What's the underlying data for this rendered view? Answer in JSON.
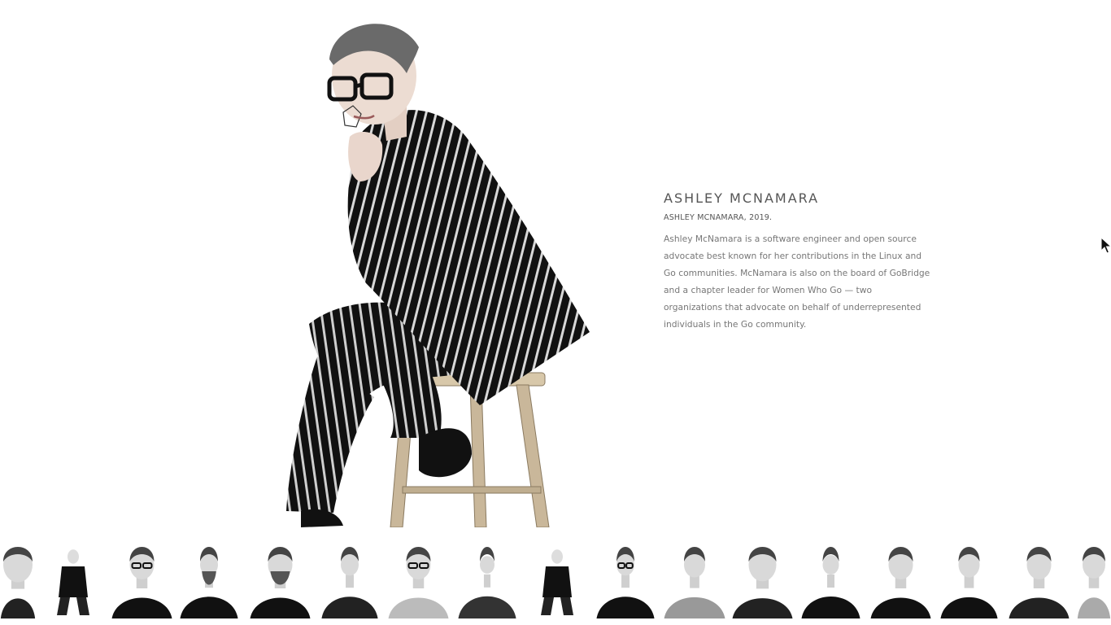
{
  "feature": {
    "name": "ASHLEY MCNAMARA",
    "credit": "ASHLEY MCNAMARA, 2019.",
    "bio": "Ashley McNamara is a software engineer and open source advocate best known for her contributions in the Linux and Go communities. McNamara is also on the board of GoBridge and a chapter leader for Women Who Go — two organizations that advocate on behalf of underrepresented individuals in the Go community."
  },
  "portrait": {
    "icon": "person-on-stool-photo"
  },
  "cursor": {
    "icon": "mouse-pointer-icon"
  },
  "thumbnails": [
    {
      "id": "thumb-1",
      "icon": "portrait-photo"
    },
    {
      "id": "thumb-2",
      "icon": "portrait-photo"
    },
    {
      "id": "thumb-3",
      "icon": "portrait-photo"
    },
    {
      "id": "thumb-4",
      "icon": "portrait-photo"
    },
    {
      "id": "thumb-5",
      "icon": "portrait-photo"
    },
    {
      "id": "thumb-6",
      "icon": "portrait-photo"
    },
    {
      "id": "thumb-7",
      "icon": "portrait-photo"
    },
    {
      "id": "thumb-8",
      "icon": "portrait-photo"
    },
    {
      "id": "thumb-9",
      "icon": "portrait-photo"
    },
    {
      "id": "thumb-10",
      "icon": "portrait-photo"
    },
    {
      "id": "thumb-11",
      "icon": "portrait-photo"
    },
    {
      "id": "thumb-12",
      "icon": "portrait-photo"
    },
    {
      "id": "thumb-13",
      "icon": "portrait-photo"
    },
    {
      "id": "thumb-14",
      "icon": "portrait-photo"
    },
    {
      "id": "thumb-15",
      "icon": "portrait-photo"
    },
    {
      "id": "thumb-16",
      "icon": "portrait-photo"
    },
    {
      "id": "thumb-17",
      "icon": "portrait-photo"
    }
  ],
  "colors": {
    "background": "#ffffff",
    "heading": "#555555",
    "body_text": "#777777"
  }
}
